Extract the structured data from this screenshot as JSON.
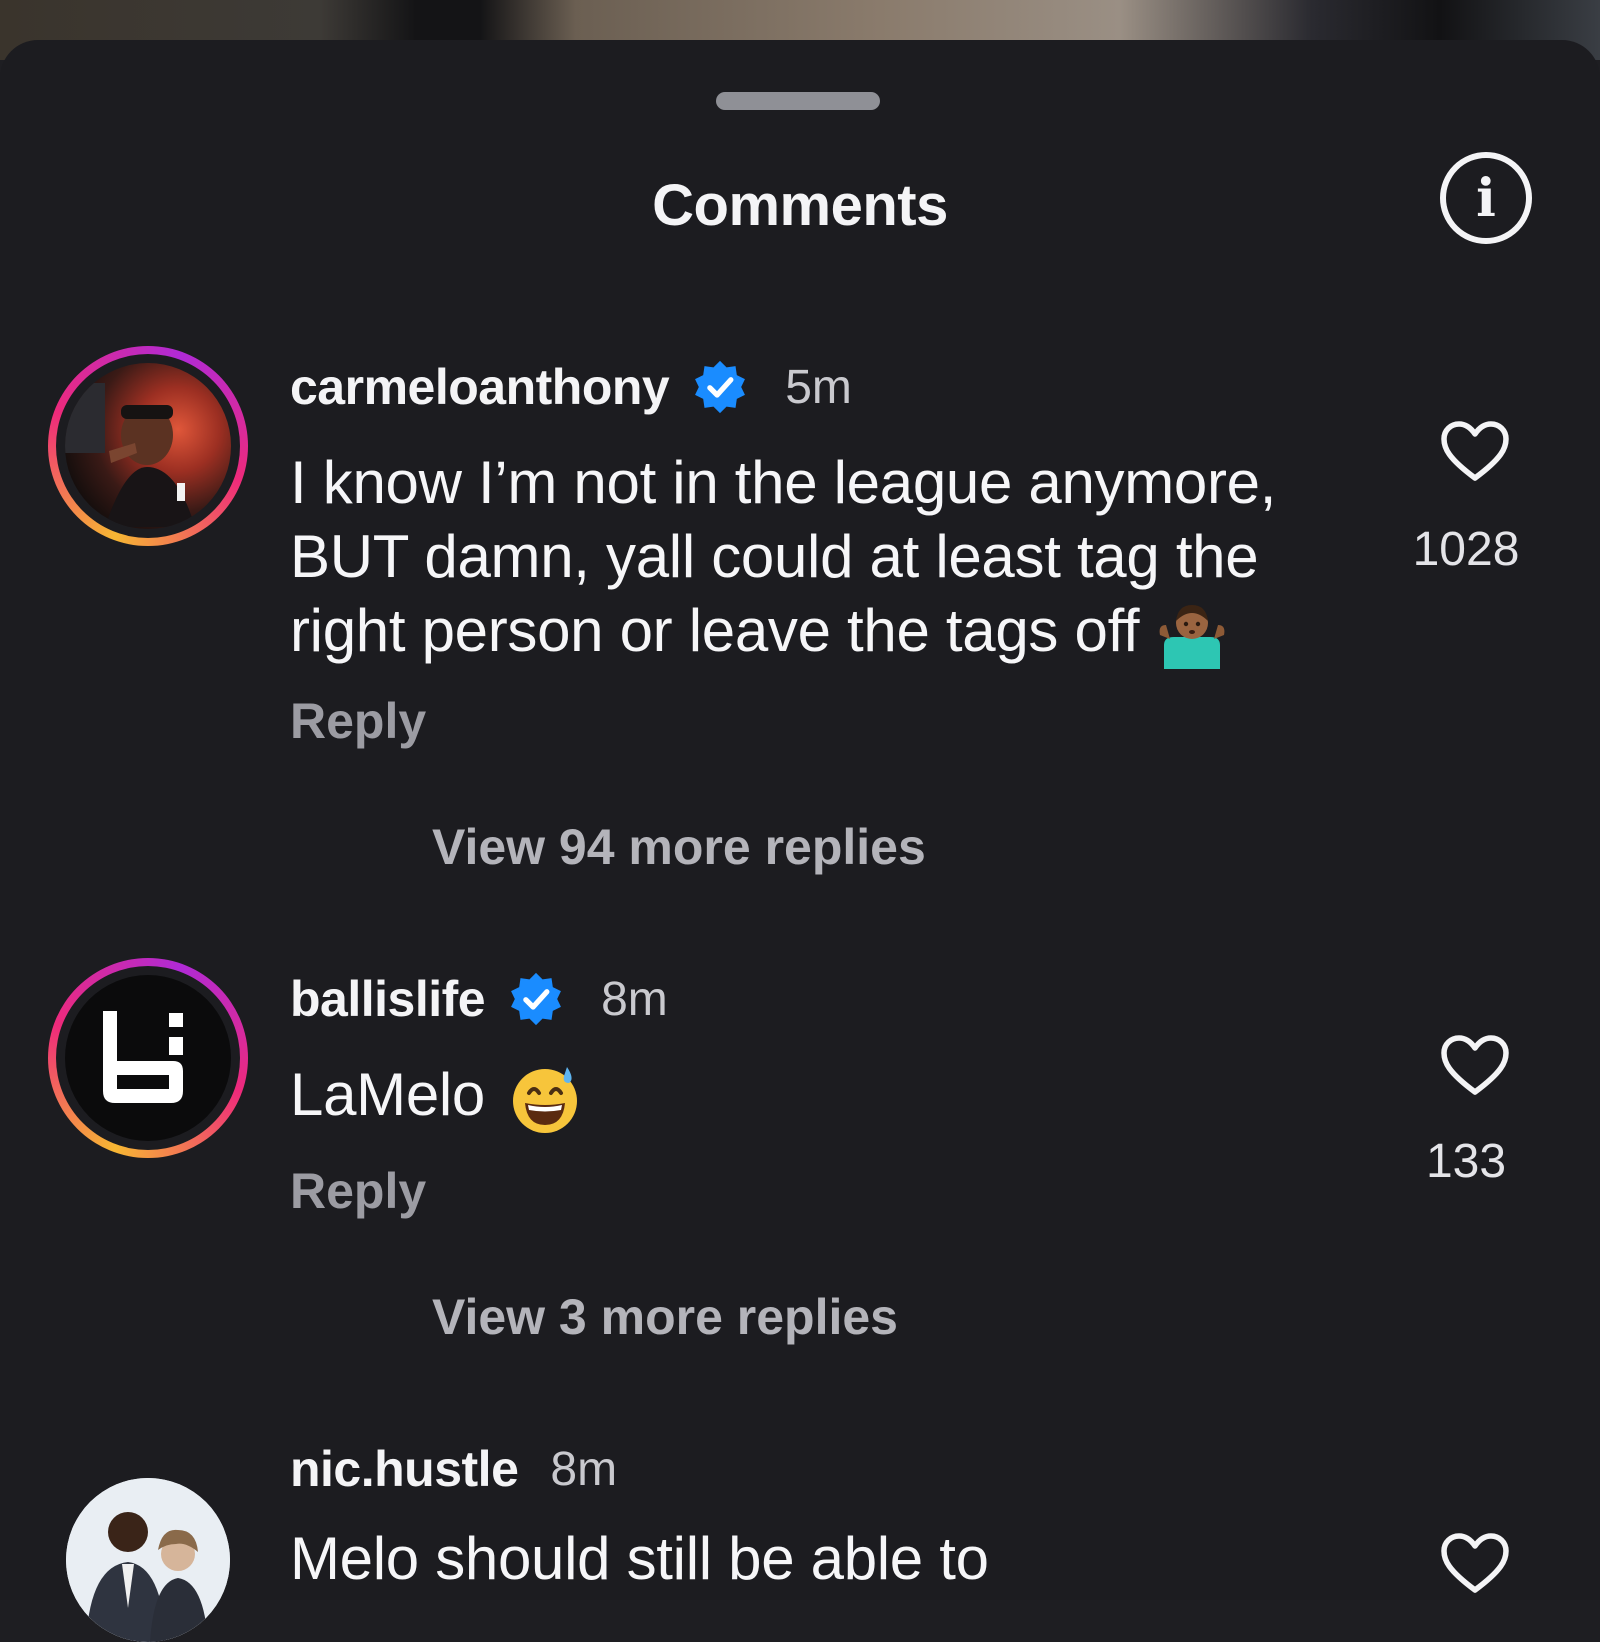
{
  "header": {
    "title": "Comments"
  },
  "comments": [
    {
      "username": "carmeloanthony",
      "verified": true,
      "time": "5m",
      "text": "I know I’m not in the league anymore, BUT damn, yall could at least tag the right person or leave the tags off",
      "emoji": "person-shrugging-emoji",
      "likes": "1028",
      "reply_label": "Reply",
      "view_replies": "View 94 more replies"
    },
    {
      "username": "ballislife",
      "verified": true,
      "time": "8m",
      "text": "LaMelo",
      "emoji": "grinning-sweat-emoji",
      "likes": "133",
      "reply_label": "Reply",
      "view_replies": "View 3 more replies"
    },
    {
      "username": "nic.hustle",
      "verified": false,
      "time": "8m",
      "text": "Melo should still be able to"
    }
  ],
  "colors": {
    "background": "#1c1c20",
    "verified": "#1a8cff",
    "muted": "#9c9ca3"
  }
}
